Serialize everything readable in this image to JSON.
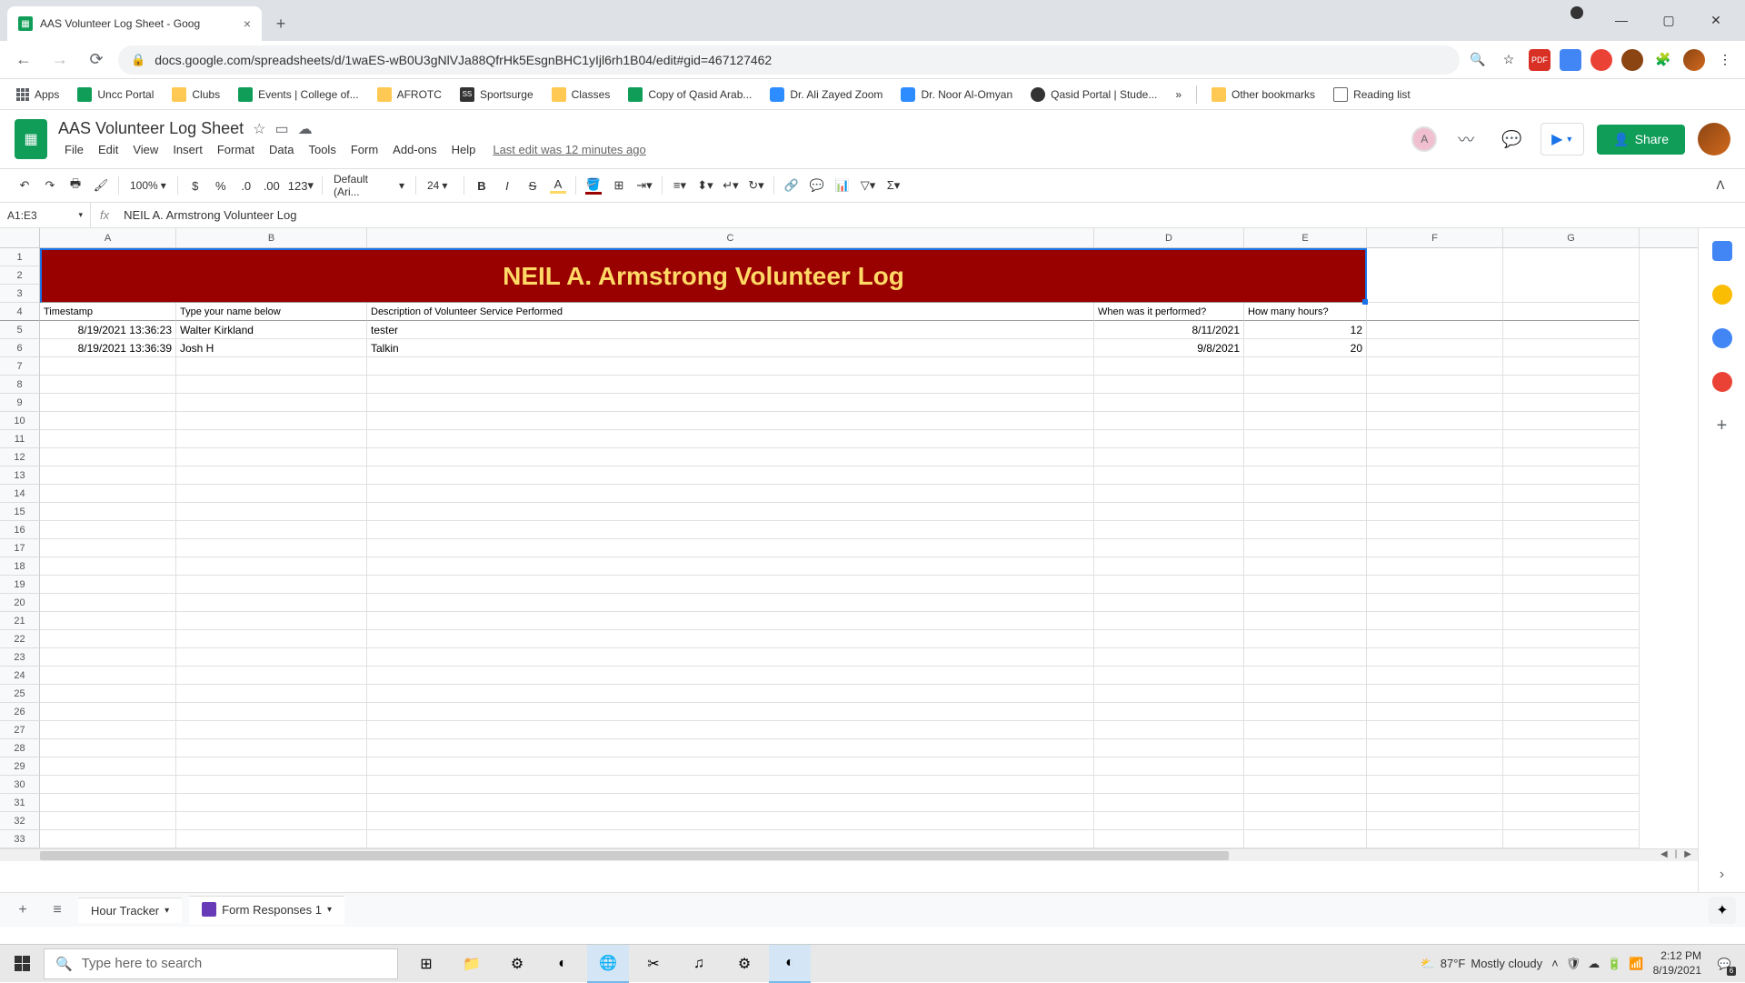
{
  "browser": {
    "tab_title": "AAS Volunteer Log Sheet - Goog",
    "url": "docs.google.com/spreadsheets/d/1waES-wB0U3gNlVJa88QfrHk5EsgnBHC1yIjl6rh1B04/edit#gid=467127462"
  },
  "bookmarks": {
    "apps": "Apps",
    "items": [
      "Uncc Portal",
      "Clubs",
      "Events | College of...",
      "AFROTC",
      "Sportsurge",
      "Classes",
      "Copy of Qasid Arab...",
      "Dr. Ali Zayed Zoom",
      "Dr. Noor Al-Omyan",
      "Qasid Portal | Stude..."
    ],
    "more": "»",
    "other": "Other bookmarks",
    "reading": "Reading list"
  },
  "sheets": {
    "title": "AAS Volunteer Log Sheet",
    "menus": [
      "File",
      "Edit",
      "View",
      "Insert",
      "Format",
      "Data",
      "Tools",
      "Form",
      "Add-ons",
      "Help"
    ],
    "last_edit": "Last edit was 12 minutes ago",
    "share": "Share",
    "collaborator": "A"
  },
  "toolbar": {
    "zoom": "100%",
    "font": "Default (Ari...",
    "size": "24",
    "decimal_dec": ".0",
    "decimal_inc": ".00",
    "more_num": "123"
  },
  "formula": {
    "name_box": "A1:E3",
    "value": "NEIL A. Armstrong Volunteer Log"
  },
  "grid": {
    "columns": [
      "A",
      "B",
      "C",
      "D",
      "E",
      "F",
      "G"
    ],
    "banner": "NEIL A. Armstrong Volunteer Log",
    "headers": {
      "timestamp": "Timestamp",
      "name": "Type your name below",
      "desc": "Description of Volunteer Service Performed",
      "when": "When was it performed?",
      "hours": "How many hours?"
    },
    "rows": [
      {
        "ts": "8/19/2021 13:36:23",
        "name": "Walter Kirkland",
        "desc": "tester",
        "when": "8/11/2021",
        "hours": "12"
      },
      {
        "ts": "8/19/2021 13:36:39",
        "name": "Josh H",
        "desc": "Talkin",
        "when": "9/8/2021",
        "hours": "20"
      }
    ]
  },
  "tabs": {
    "tab1": "Hour Tracker",
    "tab2": "Form Responses 1"
  },
  "taskbar": {
    "search_placeholder": "Type here to search",
    "weather_temp": "87°F",
    "weather_desc": "Mostly cloudy",
    "time": "2:12 PM",
    "date": "8/19/2021",
    "notif_count": "6"
  }
}
